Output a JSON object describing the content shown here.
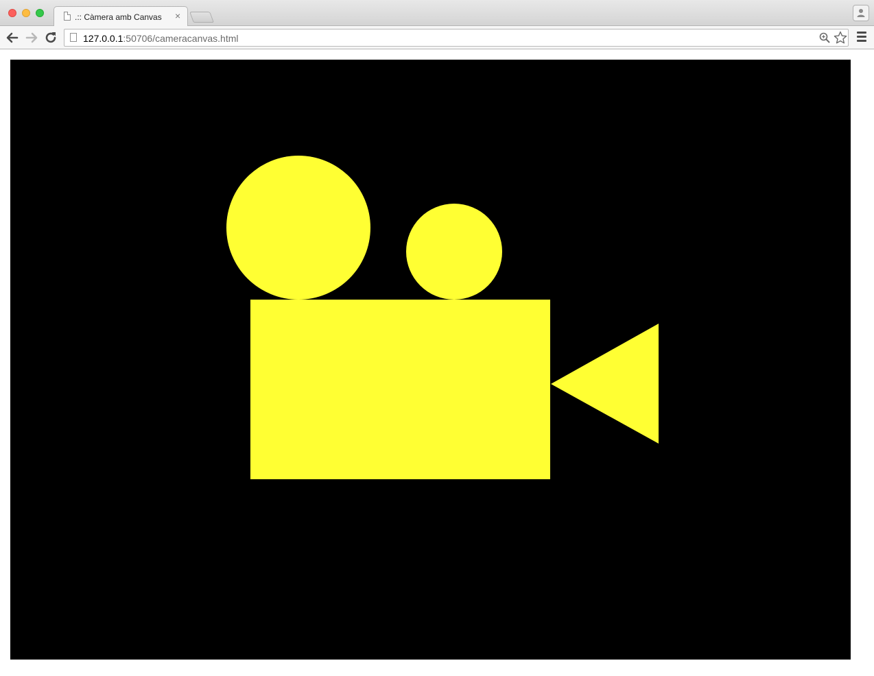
{
  "browser": {
    "tab": {
      "title": ".:: Càmera amb Canvas",
      "close_glyph": "×",
      "favicon": "page-icon"
    },
    "new_tab": "new-tab-icon",
    "profile": "person-icon",
    "nav": {
      "back": "back-arrow-icon",
      "forward": "forward-arrow-icon",
      "reload": "reload-icon"
    },
    "address": {
      "host": "127.0.0.1",
      "rest": ":50706/cameracanvas.html"
    },
    "omnibox_icons": [
      "zoom-icon",
      "star-icon"
    ],
    "menu": "hamburger-menu-icon"
  },
  "canvas": {
    "background": "#000000",
    "fill": "#ffff33",
    "shapes": [
      "reel-large",
      "reel-small",
      "camera-body",
      "camera-lens"
    ]
  }
}
